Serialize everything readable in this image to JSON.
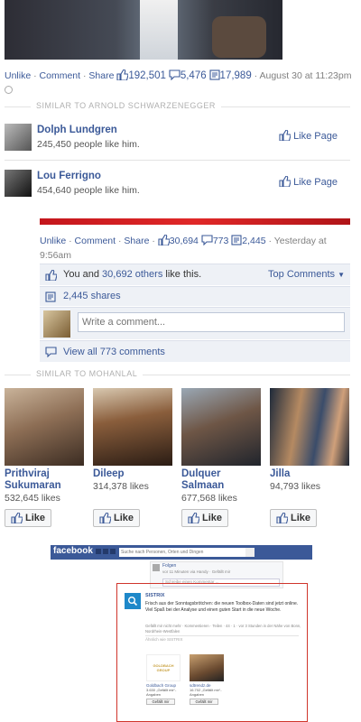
{
  "post1": {
    "actions": [
      "Unlike",
      "Comment",
      "Share"
    ],
    "likes": "192,501",
    "comments": "5,476",
    "shares": "17,989",
    "time": "August 30 at 11:23pm"
  },
  "similar1": {
    "heading": "Similar to Arnold Schwarzenegger",
    "pages": [
      {
        "name": "Dolph Lundgren",
        "likes": "245,450 people like him.",
        "button": "Like Page"
      },
      {
        "name": "Lou Ferrigno",
        "likes": "454,640 people like him.",
        "button": "Like Page"
      }
    ]
  },
  "post2": {
    "actions": [
      "Unlike",
      "Comment",
      "Share"
    ],
    "likes": "30,694",
    "comments": "773",
    "shares": "2,445",
    "time": "Yesterday at 9:56am",
    "you_text": "You and",
    "others_link": "30,692 others",
    "like_this": "like this.",
    "top_comments": "Top Comments",
    "shares_text": "2,445 shares",
    "comment_placeholder": "Write a comment...",
    "view_all": "View all 773 comments"
  },
  "similar2": {
    "heading": "Similar to Mohanlal",
    "cards": [
      {
        "name": "Prithviraj Sukumaran",
        "likes": "532,645 likes",
        "button": "Like"
      },
      {
        "name": "Dileep",
        "likes": "314,378 likes",
        "button": "Like"
      },
      {
        "name": "Dulquer Salmaan",
        "likes": "677,568 likes",
        "button": "Like"
      },
      {
        "name": "Jilla",
        "likes": "94,793 likes",
        "button": "Like"
      }
    ]
  },
  "inset": {
    "logo": "facebook",
    "search_placeholder": "Suche nach Personen, Orten und Dingen",
    "top_user": "Folgen",
    "top_line": "vor 11 Minuten via Handy · Gefällt mir",
    "comment_placeholder": "Schreibe einen Kommentar ...",
    "page_name": "SISTRIX",
    "post_text": "Frisch aus der Sonntagsbrötchen: die neuen Toolbox-Daten sind jetzt online. Viel Spaß bei der Analyse und einen guten Start in die neue Woche.",
    "post_meta": "Gefällt mir nicht mehr · Kommentieren · Teilen · 44 · 1 · vor 3 Stunden in der Nähe von Bonn, Nordrhein-Westfalen",
    "similar_label": "Ähnlich wie SISTRIX",
    "cards": [
      {
        "name": "Goldbach Group",
        "logo": "GOLDBACH GROUP",
        "likes": "3.630 „Gefällt mir“-Angaben",
        "button": "Gefällt mir"
      },
      {
        "name": "sdtrendz.de",
        "likes": "16.702 „Gefällt mir“-Angaben",
        "button": "Gefällt mir"
      }
    ],
    "frame_color": "#d0352c"
  }
}
